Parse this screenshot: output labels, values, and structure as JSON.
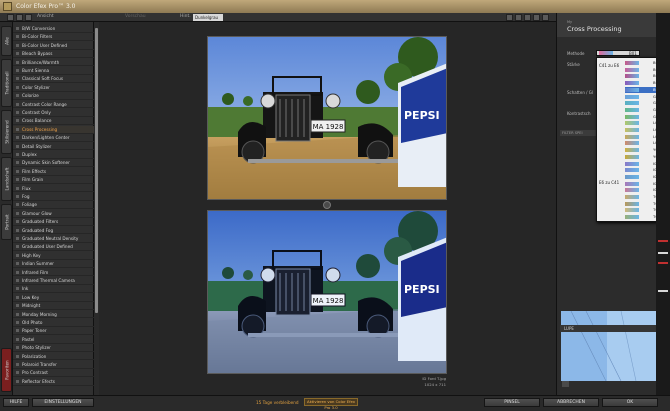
{
  "app": {
    "title": "Color Efex Pro™ 3.0"
  },
  "toolbar": {
    "ansicht": "Ansicht",
    "vorschau": "Vorschau",
    "hint": "Hint.",
    "background_value": "Dunkelgrau"
  },
  "side_tabs": [
    "Alle",
    "Traditionell",
    "Stilisierend",
    "Landschaft",
    "Portrait",
    "Favoriten"
  ],
  "filters": [
    "B/W Conversion",
    "Bi-Color Filters",
    "Bi-Color User Defined",
    "Bleach Bypass",
    "Brilliance/Warmth",
    "Burnt Sienna",
    "Classical Soft Focus",
    "Color Stylizer",
    "Colorize",
    "Contrast Color Range",
    "Contrast Only",
    "Cross Balance",
    "Cross Processing",
    "Darken/Lighten Center",
    "Detail Stylizer",
    "Duplex",
    "Dynamic Skin Softener",
    "Film Effects",
    "Film Grain",
    "Flux",
    "Fog",
    "Foliage",
    "Glamour Glow",
    "Graduated Filters",
    "Graduated Fog",
    "Graduated Neutral Density",
    "Graduated User Defined",
    "High Key",
    "Indian Summer",
    "Infrared Film",
    "Infrared Thermal Camera",
    "Ink",
    "Low Key",
    "Midnight",
    "Monday Morning",
    "Old Photo",
    "Paper Toner",
    "Pastel",
    "Photo Stylizer",
    "Polarization",
    "Polaroid Transfer",
    "Pro Contrast",
    "Reflector Efects"
  ],
  "active_filter": "Cross Processing",
  "preview": {
    "plate": "MA 1928",
    "caption_file": "ID Ford T.jpg",
    "caption_size": "1024 x 711"
  },
  "right_panel": {
    "small_label": "My",
    "title": "Cross Processing",
    "method_label": "Methode",
    "method_value": "B01",
    "strength_label": "Stärke",
    "shadows_label": "Schatten / Gl",
    "contrast_label": "Kontrastsch",
    "filter_bar": "FILTER SPEI",
    "loupe_label": "LUPE"
  },
  "dropdown": {
    "group1": "C41 zu E6",
    "group2": "E6 zu C41",
    "items": [
      {
        "code": "B01",
        "color": "#c65a8a"
      },
      {
        "code": "B02",
        "color": "#c8609a"
      },
      {
        "code": "B03",
        "color": "#b4508a"
      },
      {
        "code": "B04",
        "color": "#8a5ab8"
      },
      {
        "code": "B05",
        "color": "#5a7ac8"
      },
      {
        "code": "G01",
        "color": "#6aa0d8"
      },
      {
        "code": "G02",
        "color": "#5ab0c0"
      },
      {
        "code": "G03",
        "color": "#62b88a"
      },
      {
        "code": "G04",
        "color": "#7ab864"
      },
      {
        "code": "L01",
        "color": "#b0c86a"
      },
      {
        "code": "L02",
        "color": "#c8c060"
      },
      {
        "code": "L04",
        "color": "#c8a858"
      },
      {
        "code": "L05",
        "color": "#d08a6a"
      },
      {
        "code": "Y01",
        "color": "#d0b040"
      },
      {
        "code": "Y02",
        "color": "#c8a838"
      },
      {
        "code": "I01",
        "color": "#8a7ac8"
      },
      {
        "code": "I02",
        "color": "#7a8ad0"
      },
      {
        "code": "I03",
        "color": "#6a98c8"
      },
      {
        "code": "I04",
        "color": "#a878b8"
      },
      {
        "code": "I05",
        "color": "#c87898"
      },
      {
        "code": "T01",
        "color": "#c8a86a"
      },
      {
        "code": "T02",
        "color": "#b8985a"
      },
      {
        "code": "T03",
        "color": "#d0b878"
      },
      {
        "code": "T04",
        "color": "#98b078"
      }
    ],
    "selected": "B05"
  },
  "statusbar": {
    "help": "HILFE",
    "settings": "EINSTELLUNGEN",
    "trial": "15 Tage verbleibend",
    "buy": "Aktivieren von Color Efex Pro 3.0",
    "brush": "PINSEL",
    "cancel": "ABBRECHEN",
    "ok": "OK"
  }
}
